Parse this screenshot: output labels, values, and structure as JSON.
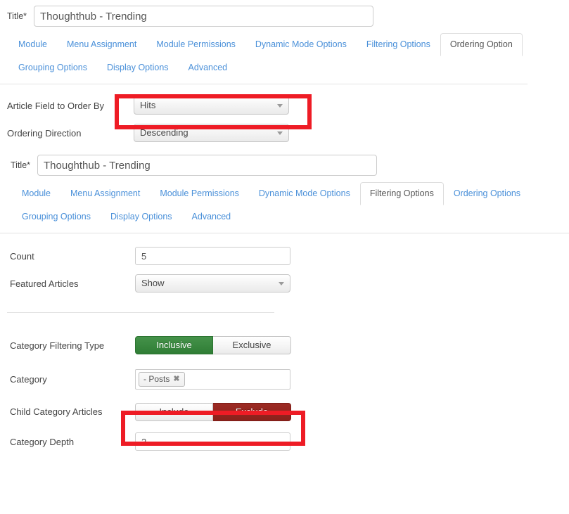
{
  "colors": {
    "link": "#4a90d9",
    "annotation": "#ee1c25",
    "active_green": "#2f7d35",
    "active_red": "#8b211b",
    "border": "#cccccc"
  },
  "section_ordering": {
    "title_label": "Title",
    "title_required_mark": "*",
    "title_value": "Thoughthub - Trending",
    "title_placeholder": "Title",
    "tabs_row1": [
      {
        "label": "Module",
        "active": false
      },
      {
        "label": "Menu Assignment",
        "active": false
      },
      {
        "label": "Module Permissions",
        "active": false
      },
      {
        "label": "Dynamic Mode Options",
        "active": false
      },
      {
        "label": "Filtering Options",
        "active": false
      },
      {
        "label": "Ordering Option",
        "active": true
      }
    ],
    "tabs_row2": [
      {
        "label": "Grouping Options",
        "active": false
      },
      {
        "label": "Display Options",
        "active": false
      },
      {
        "label": "Advanced",
        "active": false
      }
    ],
    "fields": {
      "article_field_label": "Article Field to Order By",
      "article_field_value": "Hits",
      "article_field_options": [
        "Hits"
      ],
      "ordering_direction_label": "Ordering Direction",
      "ordering_direction_value": "Descending",
      "ordering_direction_options": [
        "Descending"
      ]
    }
  },
  "section_filtering": {
    "title_label": "Title",
    "title_required_mark": "*",
    "title_value": "Thoughthub - Trending",
    "title_placeholder": "Title",
    "tabs_row1": [
      {
        "label": "Module",
        "active": false
      },
      {
        "label": "Menu Assignment",
        "active": false
      },
      {
        "label": "Module Permissions",
        "active": false
      },
      {
        "label": "Dynamic Mode Options",
        "active": false
      },
      {
        "label": "Filtering Options",
        "active": true
      },
      {
        "label": "Ordering Options",
        "active": false
      }
    ],
    "tabs_row2": [
      {
        "label": "Grouping Options",
        "active": false
      },
      {
        "label": "Display Options",
        "active": false
      },
      {
        "label": "Advanced",
        "active": false
      }
    ],
    "fields": {
      "count_label": "Count",
      "count_value": "5",
      "count_placeholder": "",
      "featured_label": "Featured Articles",
      "featured_value": "Show",
      "featured_options": [
        "Show"
      ],
      "category_filtering_type_label": "Category Filtering Type",
      "category_filtering_type_options": [
        {
          "label": "Inclusive",
          "selected": true,
          "style": "green"
        },
        {
          "label": "Exclusive",
          "selected": false,
          "style": "plain"
        }
      ],
      "category_label": "Category",
      "category_tags": [
        {
          "label": "- Posts",
          "remove_icon": "✖"
        }
      ],
      "child_category_label": "Child Category Articles",
      "child_category_options": [
        {
          "label": "Include",
          "selected": false,
          "style": "plain"
        },
        {
          "label": "Exclude",
          "selected": true,
          "style": "red"
        }
      ],
      "category_depth_label": "Category Depth",
      "category_depth_value": "2",
      "category_depth_placeholder": ""
    }
  },
  "annotations": [
    {
      "name": "article-field-highlight"
    },
    {
      "name": "category-highlight"
    }
  ]
}
